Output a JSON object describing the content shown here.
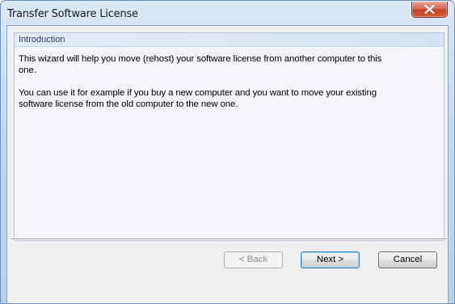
{
  "window": {
    "title": "Transfer Software License",
    "close_icon": "close-x-icon"
  },
  "panel": {
    "header": "Introduction",
    "paragraph1": "This wizard will help you move (rehost) your software license from another computer to this\none.",
    "paragraph2": "You can use it for example if you buy a new computer and you want to move your existing\nsoftware license from the old computer to the new one."
  },
  "buttons": {
    "back": "< Back",
    "next": "Next >",
    "cancel": "Cancel"
  },
  "colors": {
    "close_button": "#c7452a",
    "title_bar": "#c5d9f0",
    "panel_header": "#dbe5f4"
  }
}
